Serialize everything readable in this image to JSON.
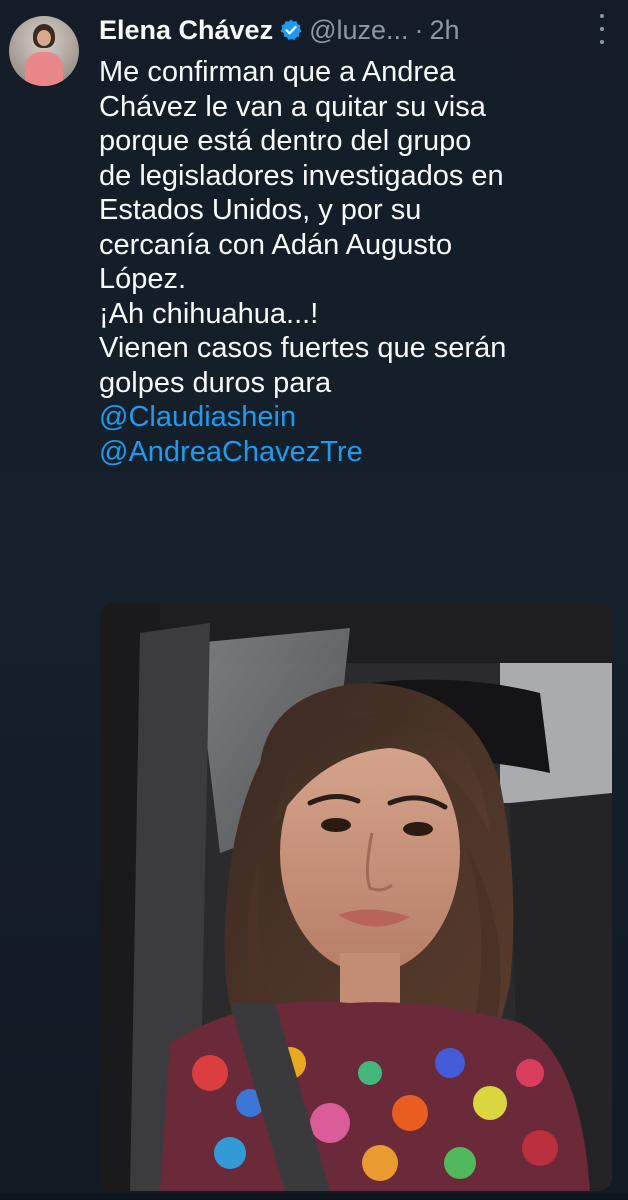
{
  "tweet": {
    "author_name": "Elena Chávez",
    "handle": "@luze...",
    "separator": "·",
    "time": "2h",
    "verified_icon": "verified-badge-icon",
    "more_icon": "more-vertical-icon",
    "body_lines": [
      "Me confirman que a Andrea",
      "Chávez le van a quitar su visa",
      "porque está dentro del grupo",
      "de legisladores investigados en",
      "Estados Unidos, y por su",
      "cercanía con Adán Augusto",
      "López.",
      "¡Ah chihuahua...!",
      "Vienen casos fuertes que serán",
      "golpes duros para"
    ],
    "mentions": [
      "@Claudiashein",
      "@AndreaChavezTre"
    ]
  },
  "colors": {
    "background": "#15202b",
    "text": "#f7f9f9",
    "secondary": "#8b98a5",
    "link": "#1d9bf0",
    "verified": "#1d9bf0"
  }
}
